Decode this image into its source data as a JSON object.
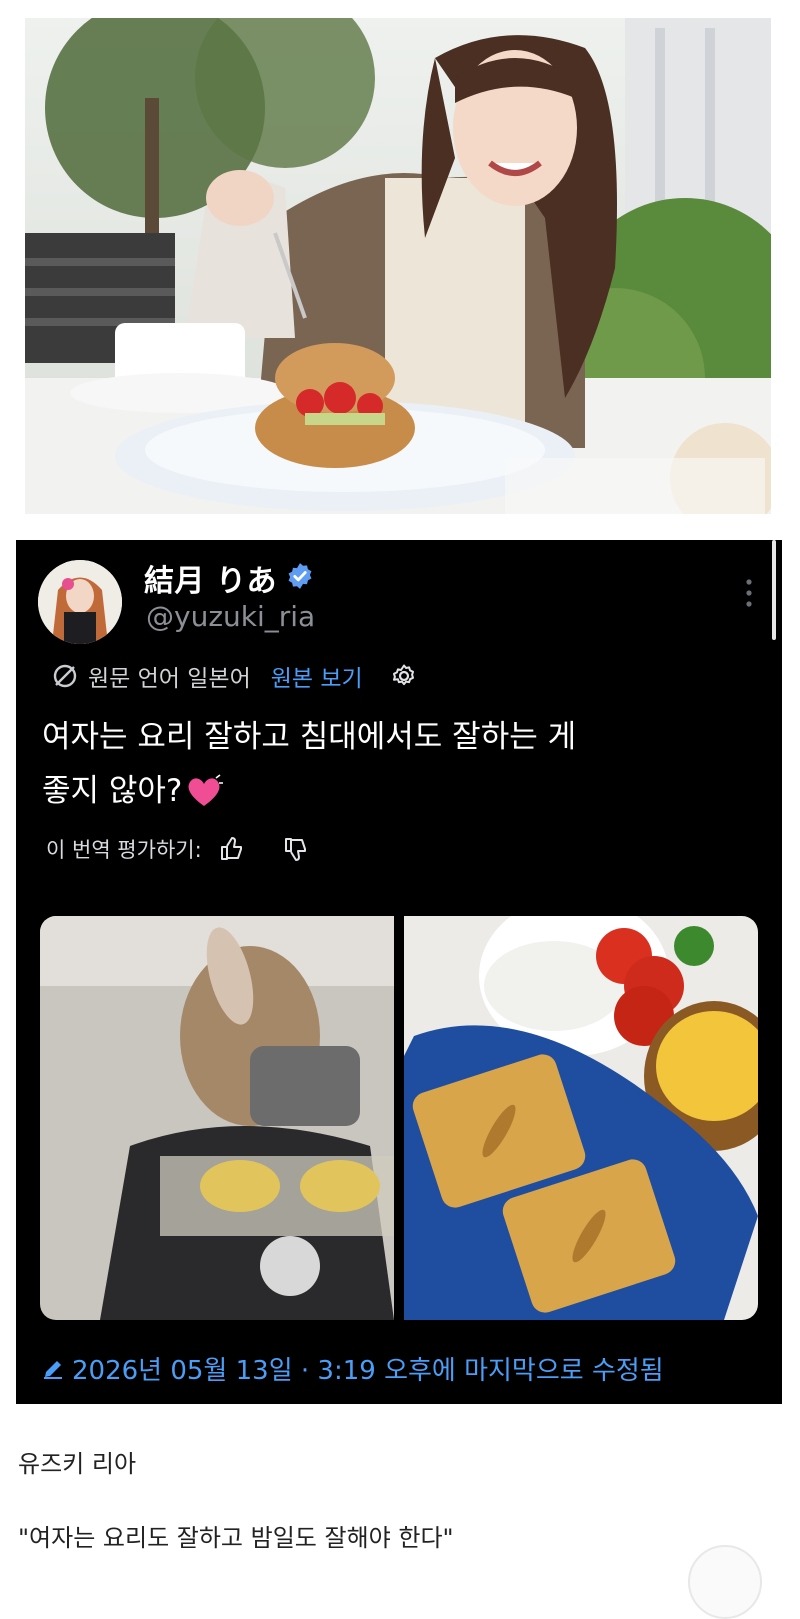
{
  "profile": {
    "display_name": "結月 りあ",
    "handle": "@yuzuki_ria"
  },
  "translation": {
    "original_language": "원문 언어 일본어",
    "show_original": "원본 보기",
    "rate_label": "이 번역 평가하기:"
  },
  "tweet": {
    "line1": "여자는 요리 잘하고 침대에서도 잘하는 게",
    "line2": "좋지 않아?"
  },
  "edited": {
    "text": "2026년 05월 13일 · 3:19 오후에 마지막으로 수정됨"
  },
  "caption": {
    "name": "유즈키 리아",
    "quote": "\"여자는 요리도 잘하고 밤일도 잘해야 한다\""
  },
  "colors": {
    "card_bg": "#000000",
    "link_blue": "#4b9ef7",
    "verified_blue": "#1d9bf0"
  },
  "icons": [
    "no-translate-icon",
    "gear-icon",
    "thumbs-up-icon",
    "thumbs-down-icon",
    "verified-badge-icon",
    "more-dots-icon",
    "pencil-icon",
    "heart-icon"
  ]
}
